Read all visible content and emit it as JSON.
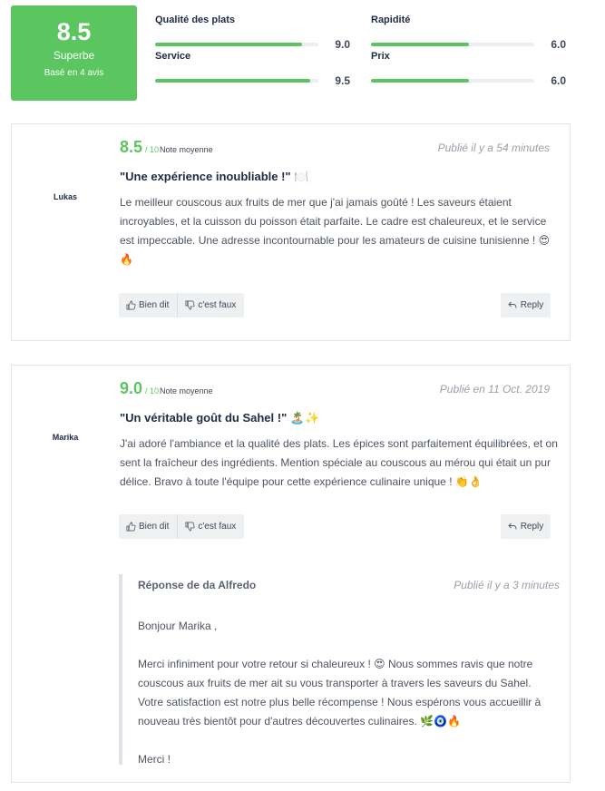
{
  "summary": {
    "score": "8.5",
    "label": "Superbe",
    "based_on": "Basé en 4 avis",
    "criteria": [
      {
        "name": "Qualité des plats",
        "value": "9.0",
        "fraction": 0.9
      },
      {
        "name": "Rapidité",
        "value": "6.0",
        "fraction": 0.6
      },
      {
        "name": "Service",
        "value": "9.5",
        "fraction": 0.95
      },
      {
        "name": "Prix",
        "value": "6.0",
        "fraction": 0.6
      }
    ]
  },
  "reviews": [
    {
      "author": "Lukas",
      "rating": "8.5",
      "rating_scale": "/ 10",
      "rating_note": "Note moyenne",
      "date": "Publié il y a 54 minutes",
      "title": "\"Une expérience inoubliable !\" 🍽️",
      "body": "Le meilleur couscous aux fruits de mer que j'ai jamais goûté ! Les saveurs étaient incroyables, et la cuisson du poisson était parfaite. Le cadre est chaleureux, et le service est impeccable. Une adresse incontournable pour les amateurs de cuisine tunisienne ! 😍🔥",
      "like_label": "Bien dit",
      "dislike_label": "c'est faux",
      "reply_label": "Reply"
    },
    {
      "author": "Marika",
      "rating": "9.0",
      "rating_scale": "/ 10",
      "rating_note": "Note moyenne",
      "date": "Publié en 11 Oct. 2019",
      "title": "\"Un véritable goût du Sahel !\" 🏝️✨",
      "body": "J'ai adoré l'ambiance et la qualité des plats. Les épices sont parfaitement équilibrées, et on sent la fraîcheur des ingrédients. Mention spéciale au couscous au mérou qui était un pur délice. Bravo à toute l'équipe pour cette expérience culinaire unique ! 👏👌",
      "like_label": "Bien dit",
      "dislike_label": "c'est faux",
      "reply_label": "Reply",
      "response": {
        "header": "Réponse de da Alfredo",
        "date": "Publié il y a 3 minutes",
        "paragraphs": [
          "Bonjour Marika ,",
          "",
          "Merci infiniment pour votre retour si chaleureux ! 😍 Nous sommes ravis que notre couscous aux fruits de mer ait su vous transporter à travers les saveurs du Sahel. Votre satisfaction est notre plus belle récompense ! Nous espérons vous accueillir à nouveau très bientôt pour d'autres découvertes culinaires. 🌿🧿🔥",
          "",
          "Merci !"
        ]
      }
    }
  ],
  "colors": {
    "accent": "#5bc660",
    "track": "#eceef1",
    "heading": "#1f2a44",
    "muted": "#9aa0a9"
  }
}
